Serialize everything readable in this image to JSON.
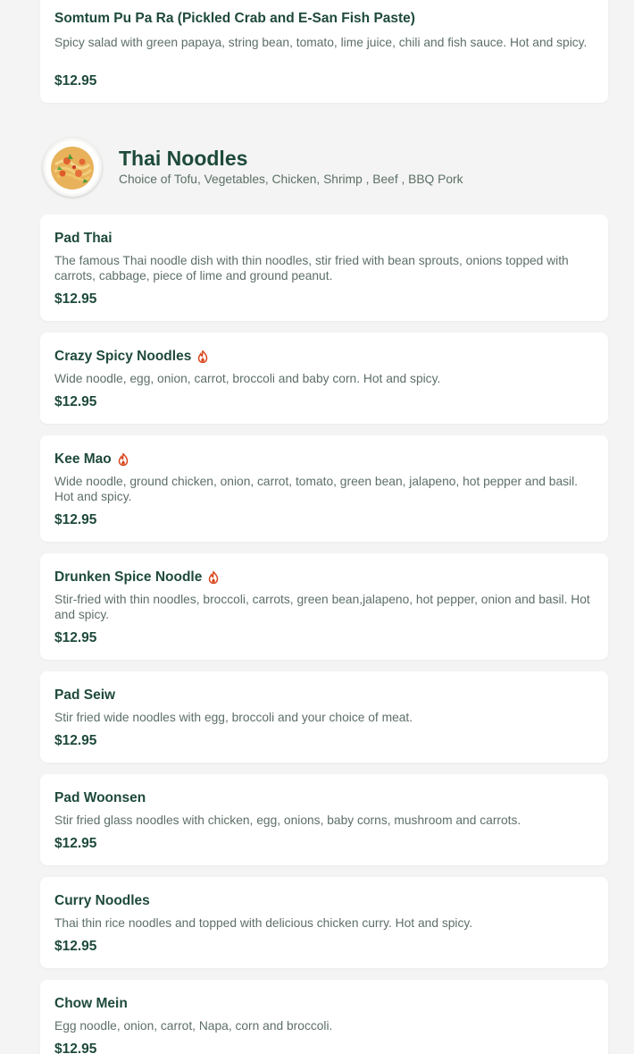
{
  "top_item": {
    "name": "Somtum Pu Pa Ra (Pickled Crab and E-San Fish Paste)",
    "description": "Spicy salad with green papaya, string bean, tomato, lime juice, chili and fish sauce. Hot and spicy.",
    "price": "$12.95"
  },
  "section": {
    "title": "Thai Noodles",
    "subtitle": "Choice of Tofu, Vegetables, Chicken, Shrimp , Beef , BBQ Pork",
    "image_icon": "noodle-dish-photo"
  },
  "spicy_icon": "flame-icon",
  "colors": {
    "background": "#f3f4f3",
    "card": "#ffffff",
    "text_primary": "#1e4a3a",
    "text_secondary": "#5d6f67",
    "spicy": "#d9481f"
  },
  "items": [
    {
      "name": "Pad Thai",
      "description": "The famous Thai noodle dish with thin noodles, stir fried with bean sprouts, onions topped with carrots, cabbage, piece of lime and ground peanut.",
      "price": "$12.95",
      "spicy": false
    },
    {
      "name": "Crazy Spicy Noodles",
      "description": "Wide noodle, egg, onion, carrot, broccoli and baby corn. Hot and spicy.",
      "price": "$12.95",
      "spicy": true
    },
    {
      "name": "Kee Mao",
      "description": "Wide noodle, ground chicken, onion, carrot, tomato, green bean, jalapeno, hot pepper and basil. Hot and spicy.",
      "price": "$12.95",
      "spicy": true
    },
    {
      "name": "Drunken Spice Noodle",
      "description": "Stir-fried with thin noodles, broccoli, carrots, green bean,jalapeno, hot pepper, onion and basil. Hot and spicy.",
      "price": "$12.95",
      "spicy": true
    },
    {
      "name": "Pad Seiw",
      "description": "Stir fried wide noodles with egg, broccoli and your choice of meat.",
      "price": "$12.95",
      "spicy": false
    },
    {
      "name": "Pad Woonsen",
      "description": "Stir fried glass noodles with chicken, egg, onions, baby corns, mushroom and carrots.",
      "price": "$12.95",
      "spicy": false
    },
    {
      "name": "Curry Noodles",
      "description": "Thai thin rice noodles and topped with delicious chicken curry. Hot and spicy.",
      "price": "$12.95",
      "spicy": false
    },
    {
      "name": "Chow Mein",
      "description": "Egg noodle, onion, carrot, Napa, corn and broccoli.",
      "price": "$12.95",
      "spicy": false
    }
  ]
}
